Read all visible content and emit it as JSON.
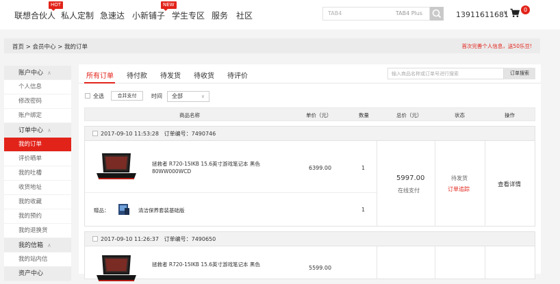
{
  "nav": {
    "items": [
      {
        "label": "联想合伙人",
        "tag": "HOT"
      },
      {
        "label": "私人定制",
        "tag": ""
      },
      {
        "label": "急速达",
        "tag": ""
      },
      {
        "label": "小新铺子",
        "tag": "NEW"
      },
      {
        "label": "学生专区",
        "tag": ""
      },
      {
        "label": "服务",
        "tag": ""
      },
      {
        "label": "社区",
        "tag": ""
      }
    ],
    "search_placeholder": "TAB4",
    "search_hint": "TAB4 Plus",
    "phone": "13911611681",
    "dropdown_caret": "∨",
    "cart_count": "0"
  },
  "breadcrumb": {
    "text": "首页 > 会员中心 > 我的订单",
    "promo": "首次完善个人信息，送50乐豆!"
  },
  "sidebar": {
    "items": [
      {
        "label": "账户中心",
        "type": "head",
        "arrow": "∧"
      },
      {
        "label": "个人信息",
        "type": "item"
      },
      {
        "label": "修改密码",
        "type": "item"
      },
      {
        "label": "账户绑定",
        "type": "item"
      },
      {
        "label": "订单中心",
        "type": "head",
        "arrow": "∧"
      },
      {
        "label": "我的订单",
        "type": "active"
      },
      {
        "label": "评价晒单",
        "type": "item"
      },
      {
        "label": "我的吐槽",
        "type": "item"
      },
      {
        "label": "收货地址",
        "type": "item"
      },
      {
        "label": "我的收藏",
        "type": "item"
      },
      {
        "label": "我的预约",
        "type": "item"
      },
      {
        "label": "我的退换货",
        "type": "item"
      },
      {
        "label": "我的信箱",
        "type": "head",
        "arrow": "∧"
      },
      {
        "label": "我的站内信",
        "type": "item"
      },
      {
        "label": "资产中心",
        "type": "head",
        "arrow": ""
      }
    ]
  },
  "tabs": [
    {
      "label": "所有订单",
      "active": true
    },
    {
      "label": "待付款",
      "active": false
    },
    {
      "label": "待发货",
      "active": false
    },
    {
      "label": "待收货",
      "active": false
    },
    {
      "label": "待评价",
      "active": false
    }
  ],
  "order_search": {
    "placeholder": "输入商品名称或订单号进行搜索",
    "button": "订单搜索"
  },
  "toolbar": {
    "select_all": "全选",
    "merge_pay": "合并支付",
    "time_label": "时间",
    "time_value": "全部",
    "time_caret": "∨"
  },
  "table_headers": [
    "商品名称",
    "单价（元）",
    "数量",
    "总价（元）",
    "状态",
    "操作"
  ],
  "orders": [
    {
      "datetime": "2017-09-10 11:53:28",
      "order_label": "订单编号：",
      "order_no": "7490746",
      "product": "拯救者 R720-15IKB 15.6英寸游戏笔记本 黑色 80WW000WCD",
      "unit_price": "6399.00",
      "qty": "1",
      "gift_label": "赠品：",
      "gift_name": "清洁保养套装基础版",
      "gift_qty": "1",
      "total": "5997.00",
      "pay_method": "在线支付",
      "status": "待发货",
      "track": "订单追踪",
      "action": "查看详情"
    },
    {
      "datetime": "2017-09-10 11:26:37",
      "order_label": "订单编号：",
      "order_no": "7490650",
      "product": "拯救者 R720-15IKB 15.6英寸游戏笔记本 黑色",
      "unit_price": "5599.00"
    }
  ]
}
